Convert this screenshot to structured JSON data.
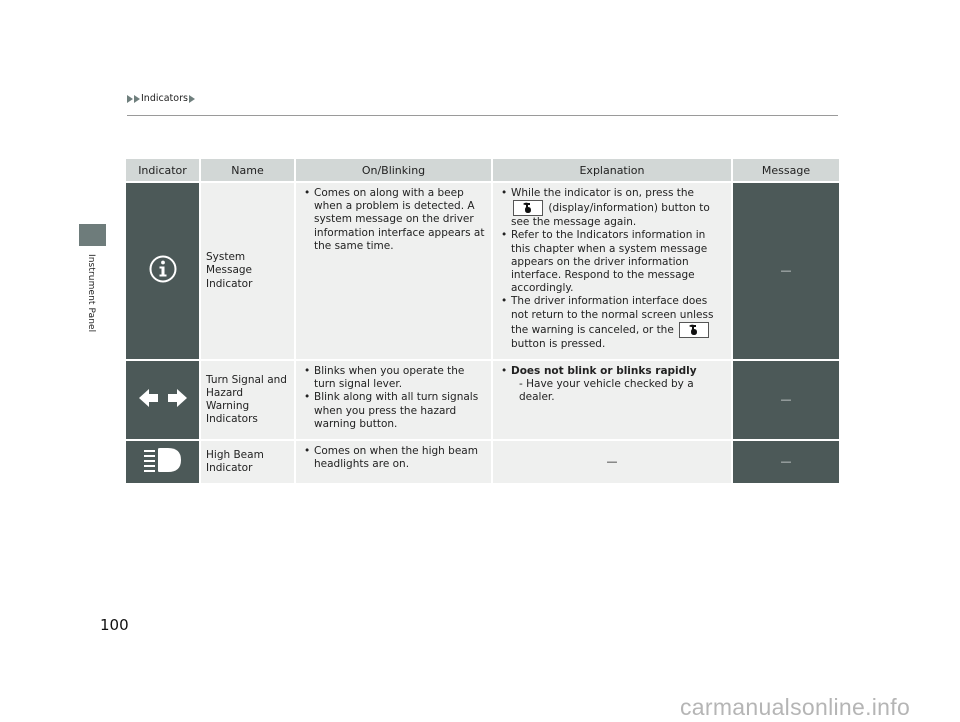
{
  "header": {
    "breadcrumb": "Indicators"
  },
  "side_tab": {
    "label": "Instrument Panel"
  },
  "table": {
    "columns": [
      "Indicator",
      "Name",
      "On/Blinking",
      "Explanation",
      "Message"
    ],
    "rows": [
      {
        "icon": "info-circle-icon",
        "name": "System Message Indicator",
        "on_blinking": [
          "Comes on along with a beep when a problem is detected. A system message on the driver information interface appears at the same time."
        ],
        "explanation": {
          "item1_pre": "While the indicator is on, press the",
          "item1_post": "(display/information) button to see the message again.",
          "item2": "Refer to the Indicators information in this chapter when a system message appears on the driver information interface. Respond to the message accordingly.",
          "item3_pre": "The driver information interface does not return to the normal screen unless the warning is canceled, or the",
          "item3_post": "button is pressed."
        },
        "message": "—"
      },
      {
        "icon": "turn-signal-arrows-icon",
        "name": "Turn Signal and Hazard Warning Indicators",
        "on_blinking": [
          "Blinks when you operate the turn signal lever.",
          "Blink along with all turn signals when you press the hazard warning button."
        ],
        "explanation": {
          "bold": "Does not blink or blinks rapidly",
          "sub": "- Have your vehicle checked by a dealer."
        },
        "message": "—"
      },
      {
        "icon": "high-beam-icon",
        "name": "High Beam Indicator",
        "on_blinking": [
          "Comes on when the high beam headlights are on."
        ],
        "explanation": "—",
        "message": "—"
      }
    ]
  },
  "footer": {
    "page_number": "100",
    "watermark": "carmanualsonline.info"
  }
}
